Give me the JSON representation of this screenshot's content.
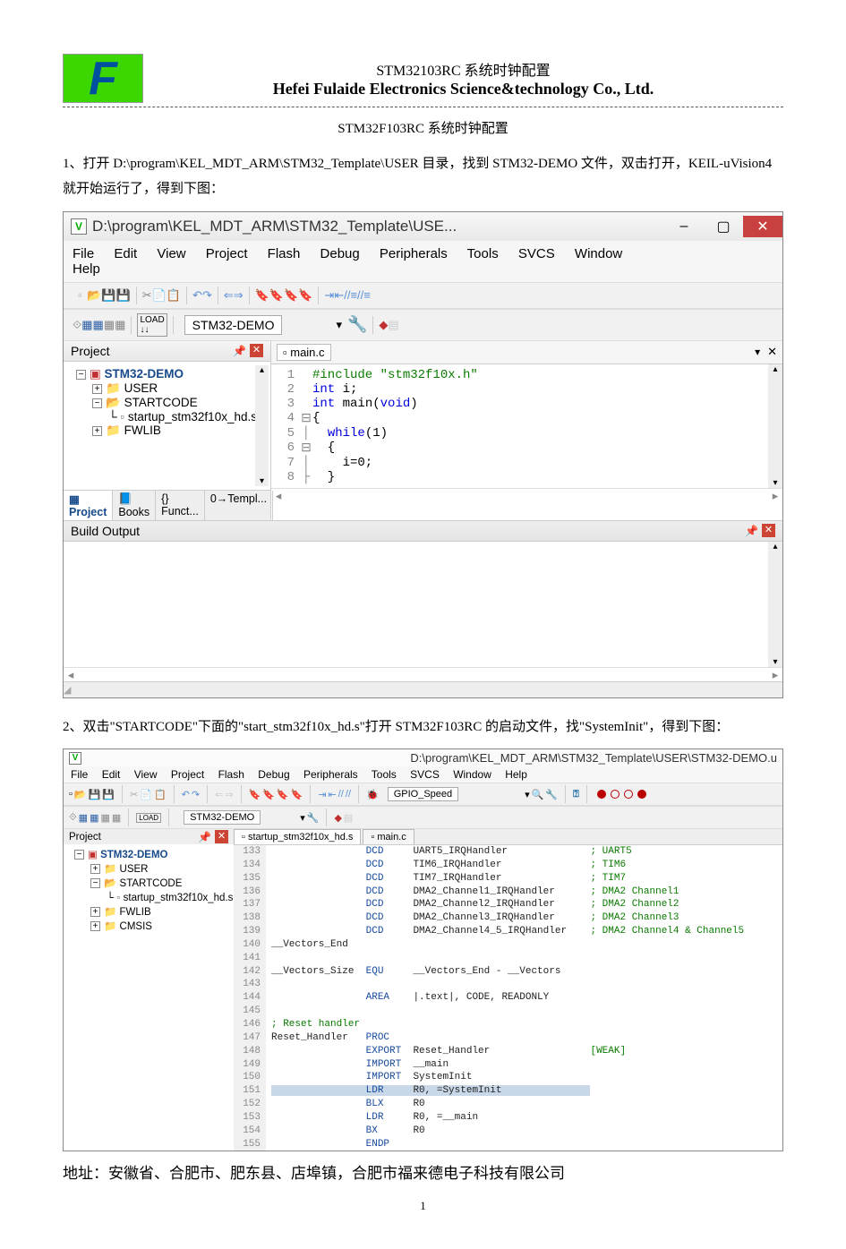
{
  "header": {
    "title_small": "STM32103RC 系统时钟配置",
    "title_bold": "Hefei Fulaide Electronics Science&technology Co., Ltd.",
    "logo_letter": "F"
  },
  "doc_title": "STM32F103RC 系统时钟配置",
  "para1": "1、打开 D:\\program\\KEL_MDT_ARM\\STM32_Template\\USER 目录，找到 STM32-DEMO 文件，双击打开，KEIL-uVision4 就开始运行了，得到下图：",
  "para2": "2、双击\"STARTCODE\"下面的\"start_stm32f10x_hd.s\"打开 STM32F103RC 的启动文件，找\"SystemInit\"，得到下图：",
  "footer": "地址：安徽省、合肥市、肥东县、店埠镇，合肥市福来德电子科技有限公司",
  "page_number": "1",
  "shot1": {
    "titlebar": "D:\\program\\KEL_MDT_ARM\\STM32_Template\\USE...",
    "menus": [
      "File",
      "Edit",
      "View",
      "Project",
      "Flash",
      "Debug",
      "Peripherals",
      "Tools",
      "SVCS",
      "Window",
      "Help"
    ],
    "target": "STM32-DEMO",
    "project_panel": "Project",
    "tree": {
      "root": "STM32-DEMO",
      "user": "USER",
      "startcode": "STARTCODE",
      "startfile": "startup_stm32f10x_hd.s",
      "fwlib": "FWLIB"
    },
    "bottom_tabs": [
      "Project",
      "Books",
      "{} Funct...",
      "0→Templ..."
    ],
    "file_tab": "main.c",
    "code": [
      {
        "n": "1",
        "fold": "",
        "pre": "",
        "pp": "#include \"stm32f10x.h\""
      },
      {
        "n": "2",
        "fold": "",
        "pre": "",
        "txt": "int i;"
      },
      {
        "n": "3",
        "fold": "",
        "pre": "",
        "txt": "int main(void)"
      },
      {
        "n": "4",
        "fold": "⊟",
        "pre": "",
        "txt": "{"
      },
      {
        "n": "5",
        "fold": "│",
        "pre": "  ",
        "txt": "while(1)"
      },
      {
        "n": "6",
        "fold": "⊟",
        "pre": "  ",
        "txt": "{"
      },
      {
        "n": "7",
        "fold": "│",
        "pre": "    ",
        "txt": "i=0;"
      },
      {
        "n": "8",
        "fold": "├",
        "pre": "  ",
        "txt": "}"
      }
    ],
    "build_output": "Build Output"
  },
  "shot2": {
    "titlebar": "D:\\program\\KEL_MDT_ARM\\STM32_Template\\USER\\STM32-DEMO.u",
    "menus": [
      "File",
      "Edit",
      "View",
      "Project",
      "Flash",
      "Debug",
      "Peripherals",
      "Tools",
      "SVCS",
      "Window",
      "Help"
    ],
    "combo1": "GPIO_Speed",
    "target": "STM32-DEMO",
    "project_panel": "Project",
    "tree": {
      "root": "STM32-DEMO",
      "user": "USER",
      "startcode": "STARTCODE",
      "startfile": "startup_stm32f10x_hd.s",
      "fwlib": "FWLIB",
      "cmsis": "CMSIS"
    },
    "tabs": [
      "startup_stm32f10x_hd.s",
      "main.c"
    ],
    "code_lines": [
      [
        "133",
        "",
        "DCD",
        "UART5_IRQHandler",
        "; UART5"
      ],
      [
        "134",
        "",
        "DCD",
        "TIM6_IRQHandler",
        "; TIM6"
      ],
      [
        "135",
        "",
        "DCD",
        "TIM7_IRQHandler",
        "; TIM7"
      ],
      [
        "136",
        "",
        "DCD",
        "DMA2_Channel1_IRQHandler",
        "; DMA2 Channel1"
      ],
      [
        "137",
        "",
        "DCD",
        "DMA2_Channel2_IRQHandler",
        "; DMA2 Channel2"
      ],
      [
        "138",
        "",
        "DCD",
        "DMA2_Channel3_IRQHandler",
        "; DMA2 Channel3"
      ],
      [
        "139",
        "",
        "DCD",
        "DMA2_Channel4_5_IRQHandler",
        "; DMA2 Channel4 & Channel5"
      ],
      [
        "140",
        "__Vectors_End",
        "",
        "",
        ""
      ],
      [
        "141",
        "",
        "",
        "",
        ""
      ],
      [
        "142",
        "__Vectors_Size",
        "EQU",
        "__Vectors_End - __Vectors",
        ""
      ],
      [
        "143",
        "",
        "",
        "",
        ""
      ],
      [
        "144",
        "",
        "AREA",
        "|.text|, CODE, READONLY",
        ""
      ],
      [
        "145",
        "",
        "",
        "",
        ""
      ],
      [
        "146",
        "; Reset handler",
        "",
        "",
        ""
      ],
      [
        "147",
        "Reset_Handler",
        "PROC",
        "",
        ""
      ],
      [
        "148",
        "",
        "EXPORT",
        "Reset_Handler",
        "[WEAK]"
      ],
      [
        "149",
        "",
        "IMPORT",
        "__main",
        ""
      ],
      [
        "150",
        "",
        "IMPORT",
        "SystemInit",
        ""
      ],
      [
        "151",
        "",
        "LDR",
        "R0, =SystemInit",
        ""
      ],
      [
        "152",
        "",
        "BLX",
        "R0",
        ""
      ],
      [
        "153",
        "",
        "LDR",
        "R0, =__main",
        ""
      ],
      [
        "154",
        "",
        "BX",
        "R0",
        ""
      ],
      [
        "155",
        "",
        "ENDP",
        "",
        ""
      ]
    ]
  }
}
